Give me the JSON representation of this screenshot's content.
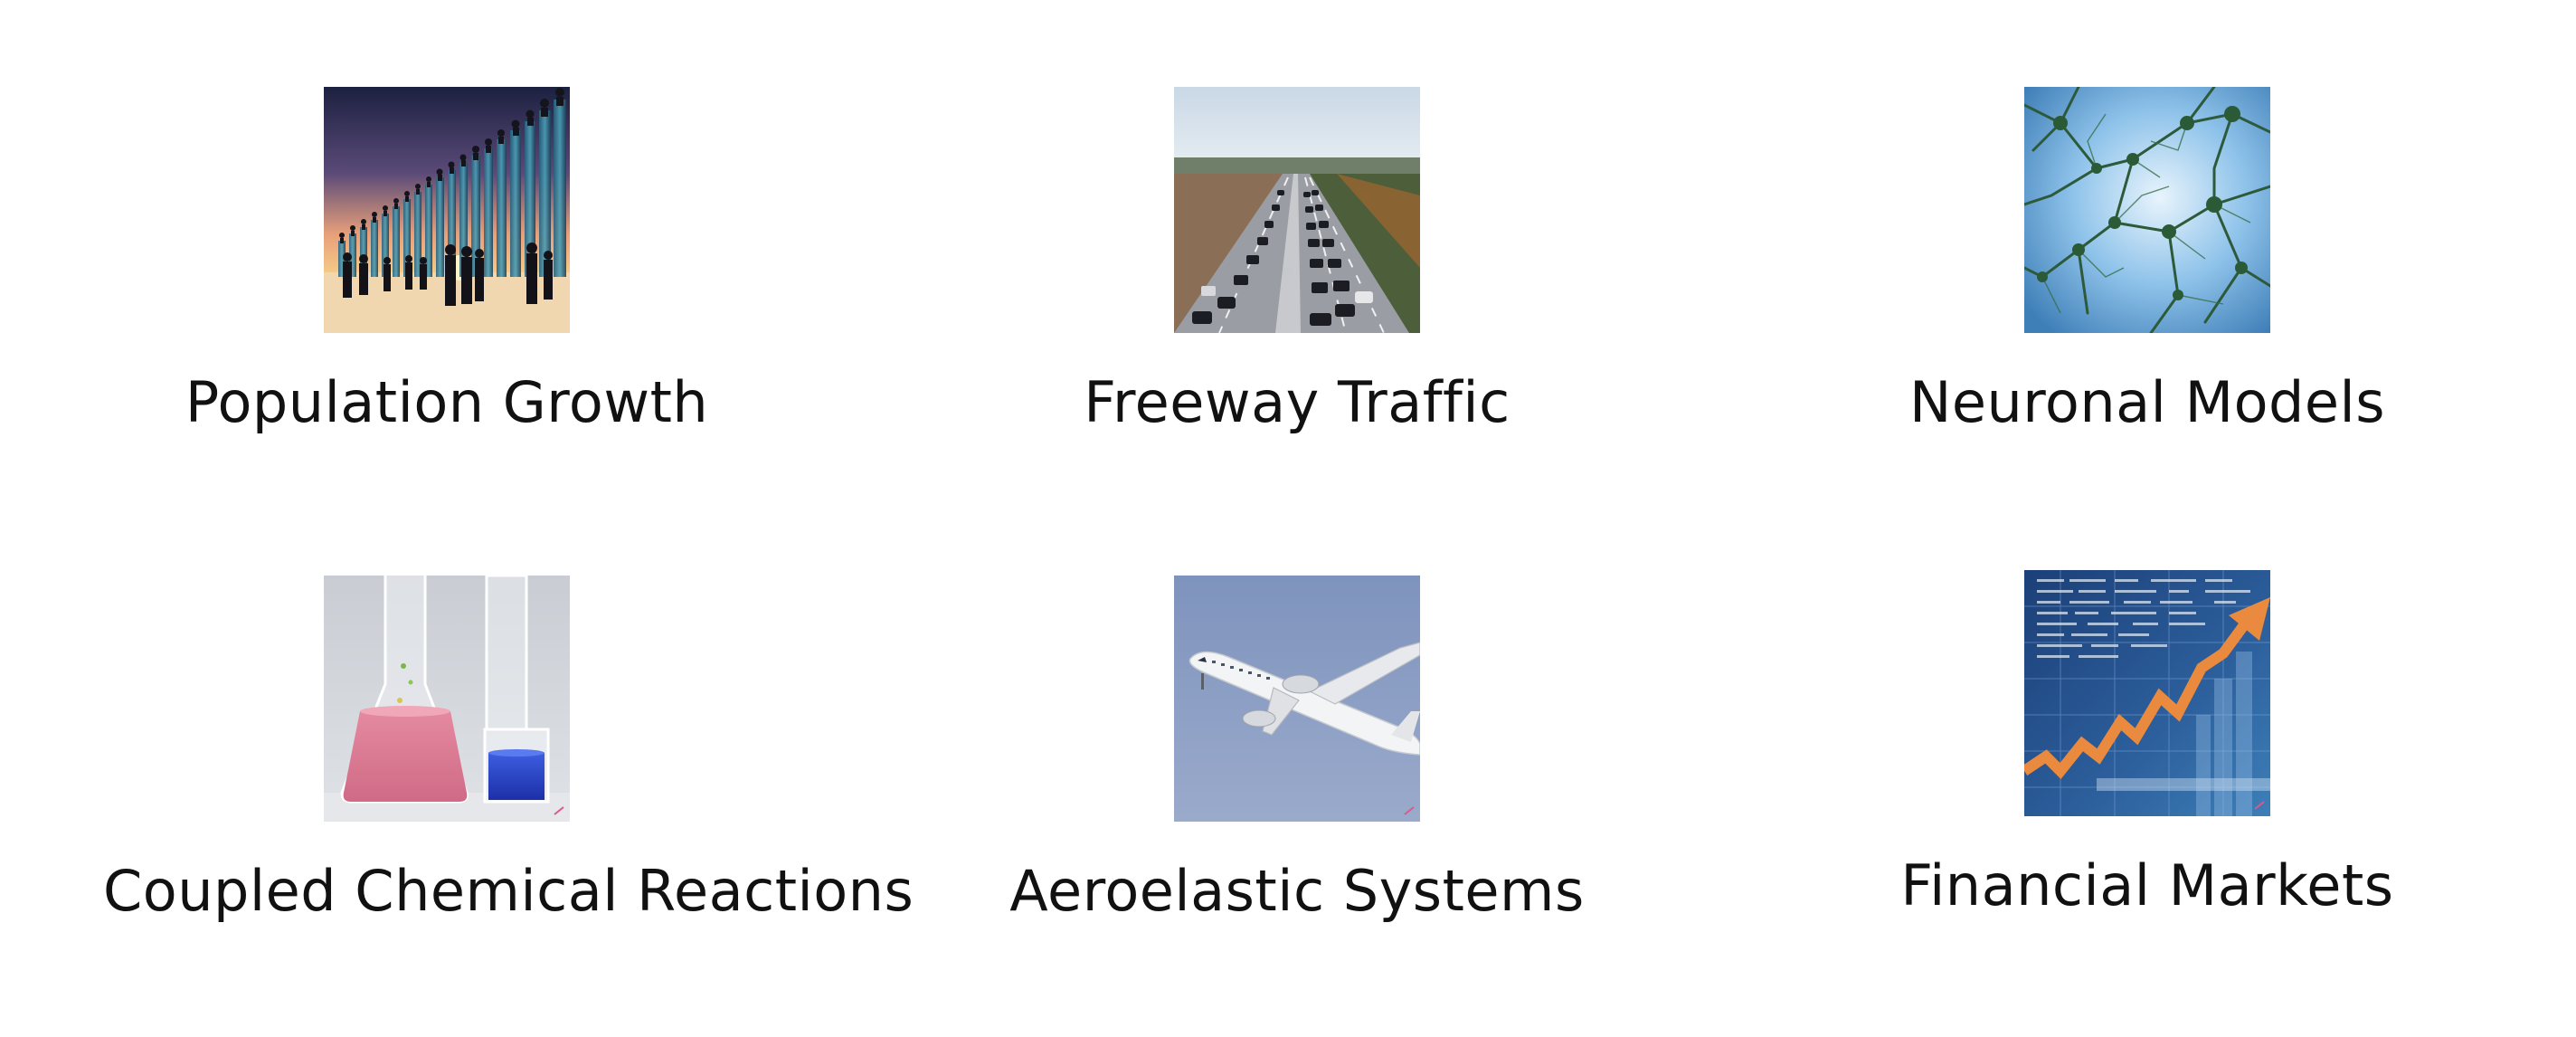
{
  "tiles": [
    {
      "caption": "Population Growth",
      "image": "population-silhouettes-image"
    },
    {
      "caption": "Freeway Traffic",
      "image": "freeway-traffic-image"
    },
    {
      "caption": "Neuronal Models",
      "image": "neuron-network-image"
    },
    {
      "caption": "Coupled Chemical Reactions",
      "image": "chemistry-flasks-image"
    },
    {
      "caption": "Aeroelastic Systems",
      "image": "airplane-image"
    },
    {
      "caption": "Financial Markets",
      "image": "stock-chart-image"
    }
  ]
}
